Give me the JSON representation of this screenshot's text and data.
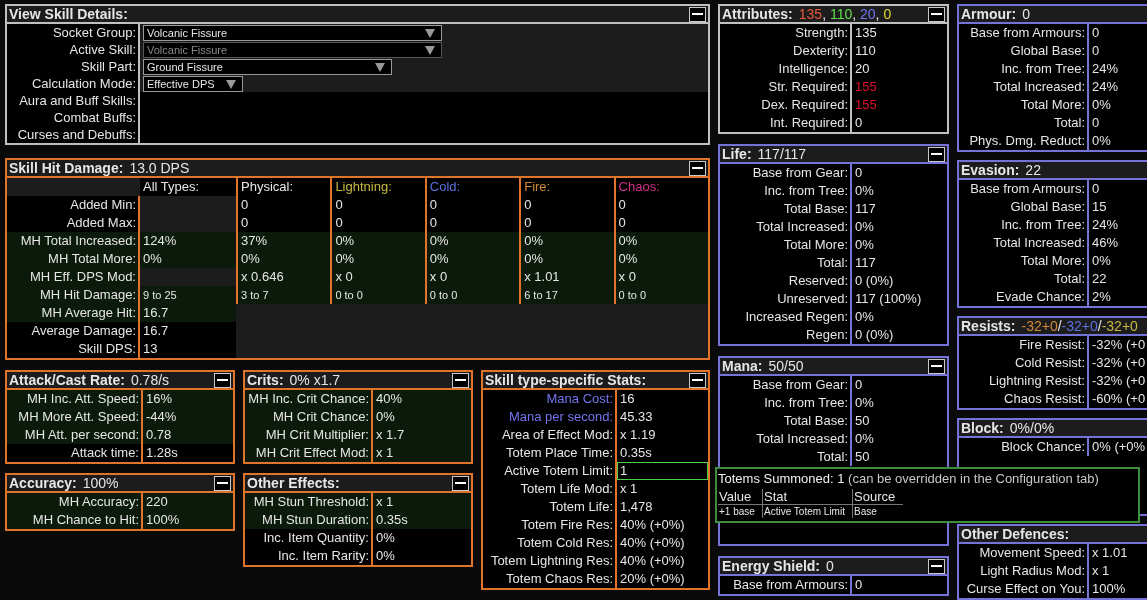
{
  "view_skill_details": {
    "title": "View Skill Details:",
    "collapse_button": true,
    "rows": [
      {
        "label": "Socket Group:",
        "kind": "dropdown",
        "value": "Volcanic Fissure",
        "disabled": false
      },
      {
        "label": "Active Skill:",
        "kind": "dropdown",
        "value": "Volcanic Fissure",
        "disabled": true
      },
      {
        "label": "Skill Part:",
        "kind": "dropdown",
        "value": "Ground Fissure",
        "disabled": false
      },
      {
        "label": "Calculation Mode:",
        "kind": "dropdown",
        "value": "Effective DPS",
        "disabled": false
      },
      {
        "label": "Aura and Buff Skills:",
        "kind": "empty"
      },
      {
        "label": "Combat Buffs:",
        "kind": "empty"
      },
      {
        "label": "Curses and Debuffs:",
        "kind": "empty"
      }
    ]
  },
  "skill_hit_damage": {
    "title": "Skill Hit Damage:",
    "value": "13.0 DPS",
    "collapse_button": true,
    "all_types_label": "All Types:",
    "columns": [
      {
        "label": "Physical:",
        "kind": "physical"
      },
      {
        "label": "Lightning:",
        "kind": "lightning"
      },
      {
        "label": "Cold:",
        "kind": "cold"
      },
      {
        "label": "Fire:",
        "kind": "fire"
      },
      {
        "label": "Chaos:",
        "kind": "chaos"
      }
    ],
    "rows": [
      {
        "label": "Added Min:",
        "shaded": false,
        "kind": "normal",
        "types": [
          "0",
          "0",
          "0",
          "0",
          "0"
        ]
      },
      {
        "label": "Added Max:",
        "shaded": false,
        "kind": "normal",
        "types": [
          "0",
          "0",
          "0",
          "0",
          "0"
        ]
      },
      {
        "label": "MH Total Increased:",
        "shaded": true,
        "kind": "normal",
        "all": "124%",
        "types": [
          "37%",
          "0%",
          "0%",
          "0%",
          "0%"
        ]
      },
      {
        "label": "MH Total More:",
        "shaded": true,
        "kind": "normal",
        "all": "0%",
        "types": [
          "0%",
          "0%",
          "0%",
          "0%",
          "0%"
        ]
      },
      {
        "label": "MH Eff. DPS Mod:",
        "shaded": true,
        "kind": "normal",
        "types": [
          "x 0.646",
          "x 0",
          "x 0",
          "x 1.01",
          "x 0"
        ]
      },
      {
        "label": "MH Hit Damage:",
        "shaded": true,
        "kind": "range",
        "all": "9 to 25",
        "types": [
          "3 to 7",
          "0 to 0",
          "0 to 0",
          "6 to 17",
          "0 to 0"
        ]
      },
      {
        "label": "MH Average Hit:",
        "shaded": true,
        "kind": "normal",
        "all": "16.7"
      },
      {
        "label": "Average Damage:",
        "shaded": false,
        "kind": "normal",
        "all": "16.7"
      },
      {
        "label": "Skill DPS:",
        "shaded": false,
        "kind": "normal",
        "all": "13"
      }
    ]
  },
  "stat_columns": [
    {
      "panels": [
        {
          "title": "Attack/Cast Rate:",
          "value": "0.78/s",
          "kind": "offence",
          "collapse_button": true,
          "rows": [
            {
              "label": "MH Inc. Att. Speed:",
              "value": "16%",
              "shaded": true
            },
            {
              "label": "MH More Att. Speed:",
              "value": "-44%",
              "shaded": true
            },
            {
              "label": "MH Att. per second:",
              "value": "0.78",
              "shaded": true
            },
            {
              "label": "Attack time:",
              "value": "1.28s",
              "shaded": false
            }
          ]
        },
        {
          "title": "Accuracy:",
          "value": "100%",
          "kind": "offence",
          "collapse_button": true,
          "rows": [
            {
              "label": "MH Accuracy:",
              "value": "220",
              "shaded": true
            },
            {
              "label": "MH Chance to Hit:",
              "value": "100%",
              "shaded": true
            }
          ]
        }
      ]
    },
    {
      "panels": [
        {
          "title": "Crits:",
          "value": "0% x1.7",
          "kind": "offence",
          "collapse_button": true,
          "rows": [
            {
              "label": "MH Inc. Crit Chance:",
              "value": "40%",
              "shaded": true
            },
            {
              "label": "MH Crit Chance:",
              "value": "0%",
              "shaded": true
            },
            {
              "label": "MH Crit Multiplier:",
              "value": "x 1.7",
              "shaded": true
            },
            {
              "label": "MH Crit Effect Mod:",
              "value": "x 1",
              "shaded": true
            }
          ]
        },
        {
          "title": "Other Effects:",
          "kind": "offence",
          "collapse_button": true,
          "rows": [
            {
              "label": "MH Stun Threshold:",
              "value": "x 1",
              "shaded": true
            },
            {
              "label": "MH Stun Duration:",
              "value": "0.35s",
              "shaded": true
            },
            {
              "label": "Inc. Item Quantity:",
              "value": "0%",
              "shaded": false
            },
            {
              "label": "Inc. Item Rarity:",
              "value": "0%",
              "shaded": false
            }
          ]
        }
      ]
    },
    {
      "panels": [
        {
          "title": "Skill type-specific Stats:",
          "kind": "offence",
          "collapse_button": true,
          "rows": [
            {
              "label": "Mana Cost:",
              "value": "16",
              "shaded": false,
              "kind": "mana"
            },
            {
              "label": "Mana per second:",
              "value": "45.33",
              "shaded": false,
              "kind": "mana"
            },
            {
              "label": "Area of Effect Mod:",
              "value": "x 1.19",
              "shaded": false
            },
            {
              "label": "Totem Place Time:",
              "value": "0.35s",
              "shaded": false
            },
            {
              "label": "Active Totem Limit:",
              "value": "1",
              "shaded": false,
              "highlighted": true
            },
            {
              "label": "Totem Life Mod:",
              "value": "x 1",
              "shaded": false
            },
            {
              "label": "Totem Life:",
              "value": "1,478",
              "shaded": false
            },
            {
              "label": "Totem Fire Res:",
              "value": "40% (+0%)",
              "shaded": false
            },
            {
              "label": "Totem Cold Res:",
              "value": "40% (+0%)",
              "shaded": false
            },
            {
              "label": "Totem Lightning Res:",
              "value": "40% (+0%)",
              "shaded": false
            },
            {
              "label": "Totem Chaos Res:",
              "value": "20% (+0%)",
              "shaded": false
            }
          ]
        }
      ]
    },
    {
      "panels": [
        {
          "title": "Attributes:",
          "value_parts": [
            {
              "text": "135",
              "kind": "strength"
            },
            {
              "text": ", "
            },
            {
              "text": "110",
              "kind": "dexterity"
            },
            {
              "text": ", "
            },
            {
              "text": "20",
              "kind": "intelligence"
            },
            {
              "text": ", "
            },
            {
              "text": "0",
              "kind": "omni"
            }
          ],
          "kind": "neutral",
          "collapse_button": true,
          "rows": [
            {
              "label": "Strength:",
              "value": "135",
              "shaded": false
            },
            {
              "label": "Dexterity:",
              "value": "110",
              "shaded": false
            },
            {
              "label": "Intelligence:",
              "value": "20",
              "shaded": false
            },
            {
              "label": "Str. Required:",
              "value": "155",
              "shaded": false,
              "unmet": true
            },
            {
              "label": "Dex. Required:",
              "value": "155",
              "shaded": false,
              "unmet": true
            },
            {
              "label": "Int. Required:",
              "value": "0",
              "shaded": false,
              "unmet": false
            }
          ]
        },
        {
          "title": "Life:",
          "value": "117/117",
          "kind": "defence",
          "collapse_button": true,
          "rows": [
            {
              "label": "Base from Gear:",
              "value": "0",
              "shaded": false
            },
            {
              "label": "Inc. from Tree:",
              "value": "0%",
              "shaded": false
            },
            {
              "label": "Total Base:",
              "value": "117",
              "shaded": false
            },
            {
              "label": "Total Increased:",
              "value": "0%",
              "shaded": false
            },
            {
              "label": "Total More:",
              "value": "0%",
              "shaded": false
            },
            {
              "label": "Total:",
              "value": "117",
              "shaded": false
            },
            {
              "label": "Reserved:",
              "value": "0 (0%)",
              "shaded": false
            },
            {
              "label": "Unreserved:",
              "value": "117 (100%)",
              "shaded": false
            },
            {
              "label": "Increased Regen:",
              "value": "0%",
              "shaded": false
            },
            {
              "label": "Regen:",
              "value": "0 (0%)",
              "shaded": false
            }
          ]
        },
        {
          "title": "Mana:",
          "value": "50/50",
          "kind": "defence",
          "collapse_button": true,
          "rows": [
            {
              "label": "Base from Gear:",
              "value": "0",
              "shaded": false
            },
            {
              "label": "Inc. from Tree:",
              "value": "0%",
              "shaded": false
            },
            {
              "label": "Total Base:",
              "value": "50",
              "shaded": false
            },
            {
              "label": "Total Increased:",
              "value": "0%",
              "shaded": false
            },
            {
              "label": "Total:",
              "value": "50",
              "shaded": false
            }
          ]
        },
        {
          "title": "Energy Shield:",
          "value": "0",
          "kind": "defence",
          "collapse_button": true,
          "rows": [
            {
              "label": "Base from Armours:",
              "value": "0",
              "shaded": false
            }
          ]
        }
      ]
    },
    {
      "panels": [
        {
          "title": "Armour:",
          "value": "0",
          "kind": "defence",
          "collapse_button": false,
          "rows": [
            {
              "label": "Base from Armours:",
              "value": "0",
              "shaded": false
            },
            {
              "label": "Global Base:",
              "value": "0",
              "shaded": false
            },
            {
              "label": "Inc. from Tree:",
              "value": "24%",
              "shaded": false
            },
            {
              "label": "Total Increased:",
              "value": "24%",
              "shaded": false
            },
            {
              "label": "Total More:",
              "value": "0%",
              "shaded": false
            },
            {
              "label": "Total:",
              "value": "0",
              "shaded": false
            },
            {
              "label": "Phys. Dmg. Reduct:",
              "value": "0%",
              "shaded": false
            }
          ]
        },
        {
          "title": "Evasion:",
          "value": "22",
          "kind": "defence",
          "collapse_button": false,
          "rows": [
            {
              "label": "Base from Armours:",
              "value": "0",
              "shaded": false
            },
            {
              "label": "Global Base:",
              "value": "15",
              "shaded": false
            },
            {
              "label": "Inc. from Tree:",
              "value": "24%",
              "shaded": false
            },
            {
              "label": "Total Increased:",
              "value": "46%",
              "shaded": false
            },
            {
              "label": "Total More:",
              "value": "0%",
              "shaded": false
            },
            {
              "label": "Total:",
              "value": "22",
              "shaded": false
            },
            {
              "label": "Evade Chance:",
              "value": "2%",
              "shaded": false
            }
          ]
        },
        {
          "title": "Resists:",
          "value_parts": [
            {
              "text": "-32+0",
              "kind": "fire"
            },
            {
              "text": "/"
            },
            {
              "text": "-32+0",
              "kind": "cold"
            },
            {
              "text": "/"
            },
            {
              "text": "-32+0",
              "kind": "lightning"
            }
          ],
          "kind": "defence",
          "collapse_button": false,
          "rows": [
            {
              "label": "Fire Resist:",
              "value": "-32% (+0",
              "shaded": false
            },
            {
              "label": "Cold Resist:",
              "value": "-32% (+0",
              "shaded": false
            },
            {
              "label": "Lightning Resist:",
              "value": "-32% (+0",
              "shaded": false
            },
            {
              "label": "Chaos Resist:",
              "value": "-60% (+0",
              "shaded": false
            }
          ]
        },
        {
          "title": "Block:",
          "value": "0%/0%",
          "kind": "defence",
          "collapse_button": false,
          "rows": [
            {
              "label": "Block Chance:",
              "value": "0% (+0%",
              "shaded": false
            }
          ]
        },
        {
          "title": "Other Defences:",
          "kind": "defence",
          "collapse_button": false,
          "rows": [
            {
              "label": "Movement Speed:",
              "value": "x 1.01",
              "shaded": false
            },
            {
              "label": "Light Radius Mod:",
              "value": "x 1",
              "shaded": false
            },
            {
              "label": "Curse Effect on You:",
              "value": "100%",
              "shaded": false
            }
          ]
        }
      ]
    }
  ],
  "tooltip": {
    "title": "Totems Summoned: 1",
    "note": "(can be overridden in the Configuration tab)",
    "columns": [
      "Value",
      "Stat",
      "Source"
    ],
    "rows": [
      [
        "+1 base",
        "Active Totem Limit",
        "Base"
      ]
    ]
  }
}
